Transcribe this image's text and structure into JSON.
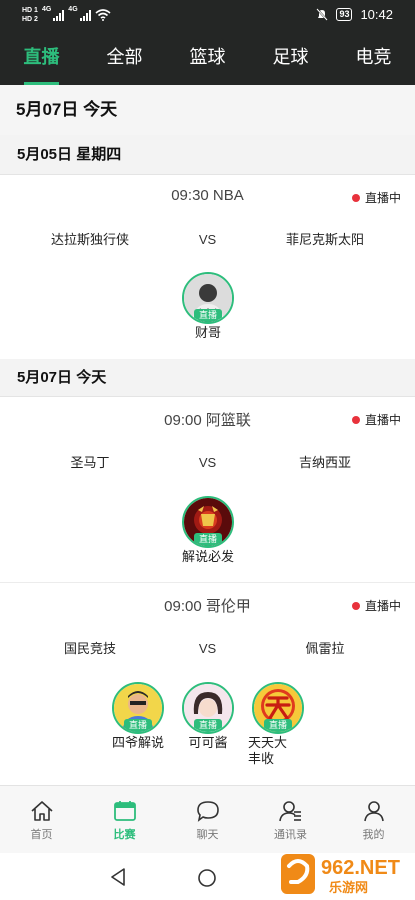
{
  "status": {
    "hd1": "HD 1",
    "hd2": "HD 2",
    "net1": "4G",
    "net2": "4G",
    "battery": "93",
    "time": "10:42"
  },
  "tabs": [
    {
      "label": "直播",
      "active": true
    },
    {
      "label": "全部",
      "active": false
    },
    {
      "label": "篮球",
      "active": false
    },
    {
      "label": "足球",
      "active": false
    },
    {
      "label": "电竞",
      "active": false
    }
  ],
  "top_date": "5月07日  今天",
  "sections": [
    {
      "date": "5月05日   星期四",
      "matches": [
        {
          "time_league": "09:30  NBA",
          "live_label": "直播中",
          "home": "达拉斯独行侠",
          "away": "菲尼克斯太阳",
          "vs": "VS",
          "anchors": [
            {
              "name": "财哥",
              "badge": "直播"
            }
          ]
        }
      ]
    },
    {
      "date": "5月07日   今天",
      "matches": [
        {
          "time_league": "09:00  阿篮联",
          "live_label": "直播中",
          "home": "圣马丁",
          "away": "吉纳西亚",
          "vs": "VS",
          "anchors": [
            {
              "name": "解说必发",
              "badge": "直播"
            }
          ]
        },
        {
          "time_league": "09:00  哥伦甲",
          "live_label": "直播中",
          "home": "国民竞技",
          "away": "佩雷拉",
          "vs": "VS",
          "anchors": [
            {
              "name": "四爷解说",
              "badge": "直播"
            },
            {
              "name": "可可酱",
              "badge": "直播"
            },
            {
              "name": "天天大丰收",
              "badge": "直播"
            }
          ]
        }
      ]
    }
  ],
  "bottom_nav": [
    {
      "label": "首页",
      "icon": "home-icon",
      "active": false
    },
    {
      "label": "比赛",
      "icon": "calendar-icon",
      "active": true
    },
    {
      "label": "聊天",
      "icon": "chat-icon",
      "active": false
    },
    {
      "label": "通讯录",
      "icon": "contacts-icon",
      "active": false
    },
    {
      "label": "我的",
      "icon": "profile-icon",
      "active": false
    }
  ],
  "watermark": {
    "brand": "962.NET",
    "sub": "乐游网"
  },
  "colors": {
    "accent": "#2dbd7c",
    "header_bg": "#242625",
    "live_dot": "#e8323c"
  }
}
